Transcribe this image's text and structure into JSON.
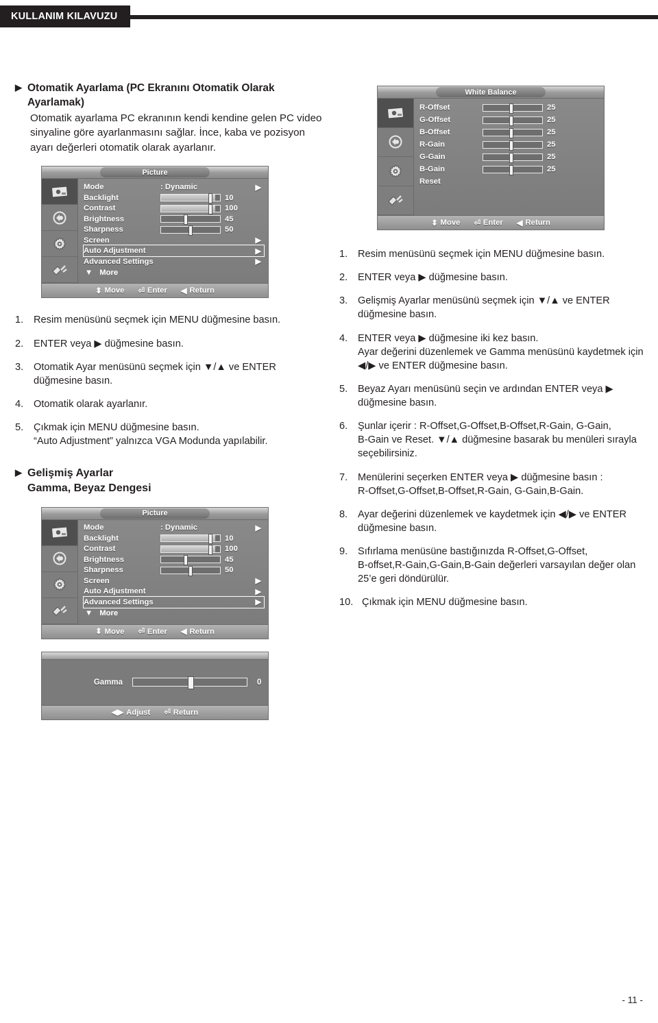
{
  "header": {
    "tab_label": "KULLANIM KILAVUZU"
  },
  "page_footer": "- 11 -",
  "left": {
    "heading": "Otomatik Ayarlama (PC Ekranını Otomatik Olarak Ayarlamak)",
    "paragraph": "Otomatik ayarlama PC ekranının kendi kendine gelen PC video sinyaline göre ayarlanmasını sağlar. İnce, kaba ve pozisyon ayarı değerleri otomatik olarak ayarlanır.",
    "steps": [
      {
        "num": "1.",
        "text": "Resim menüsünü seçmek için MENU düğmesine basın.",
        "sub": ""
      },
      {
        "num": "2.",
        "text": "ENTER veya ▶ düğmesine basın.",
        "sub": ""
      },
      {
        "num": "3.",
        "text": "Otomatik Ayar menüsünü seçmek için ▼/▲ ve ENTER",
        "sub": "düğmesine basın."
      },
      {
        "num": "4.",
        "text": "Otomatik olarak ayarlanır.",
        "sub": ""
      },
      {
        "num": "5.",
        "text": "Çıkmak için MENU düğmesine basın.",
        "sub": "“Auto Adjustment” yalnızca VGA Modunda yapılabilir."
      }
    ],
    "section_head_line1": "Gelişmiş Ayarlar",
    "section_head_line2": "Gamma, Beyaz Dengesi"
  },
  "right": {
    "steps": [
      {
        "num": "1.",
        "text": "Resim menüsünü seçmek için MENU düğmesine basın.",
        "sub": ""
      },
      {
        "num": "2.",
        "text": "ENTER veya ▶ düğmesine basın.",
        "sub": ""
      },
      {
        "num": "3.",
        "text": "Gelişmiş Ayarlar menüsünü seçmek için ▼/▲ ve ENTER",
        "sub": "düğmesine basın."
      },
      {
        "num": "4.",
        "text": "ENTER veya ▶ düğmesine iki kez basın.",
        "sub": "Ayar değerini düzenlemek ve Gamma menüsünü kaydetmek için ◀/▶ ve ENTER düğmesine basın."
      },
      {
        "num": "5.",
        "text": "Beyaz Ayarı menüsünü seçin ve ardından ENTER veya ▶",
        "sub": "düğmesine basın."
      },
      {
        "num": "6.",
        "text": "Şunlar içerir : R-Offset,G-Offset,B-Offset,R-Gain, G-Gain,",
        "sub": "B-Gain ve Reset. ▼/▲ düğmesine basarak bu menüleri sırayla seçebilirsiniz."
      },
      {
        "num": "7.",
        "text": "Menülerini seçerken ENTER veya ▶ düğmesine basın :",
        "sub": "R-Offset,G-Offset,B-Offset,R-Gain, G-Gain,B-Gain."
      },
      {
        "num": "8.",
        "text": "Ayar değerini düzenlemek ve kaydetmek için ◀/▶ ve ENTER",
        "sub": "düğmesine basın."
      },
      {
        "num": "9.",
        "text": "Sıfırlama menüsüne bastığınızda R-Offset,G-Offset,",
        "sub": "B-offset,R-Gain,G-Gain,B-Gain değerleri varsayılan değer olan 25’e geri döndürülür."
      },
      {
        "num": "10.",
        "text": "Çıkmak için MENU düğmesine basın.",
        "sub": ""
      }
    ]
  },
  "osd_common": {
    "rail_icons": [
      "picture-icon",
      "sound-icon",
      "setup-icon",
      "input-icon"
    ],
    "footer": {
      "move": "Move",
      "enter": "Enter",
      "return": "Return"
    },
    "more_label": "More"
  },
  "picture_menu_1": {
    "title": "Picture",
    "rows": [
      {
        "label": "Mode",
        "value": ": Dynamic",
        "arrow": "▶",
        "type": "value"
      },
      {
        "label": "Backlight",
        "num": "10",
        "type": "bar",
        "fill": 96,
        "knob": 80
      },
      {
        "label": "Contrast",
        "num": "100",
        "type": "bar",
        "fill": 96,
        "knob": 80
      },
      {
        "label": "Brightness",
        "num": "45",
        "type": "bar",
        "fill": 0,
        "knob": 38
      },
      {
        "label": "Sharpness",
        "num": "50",
        "type": "bar",
        "fill": 0,
        "knob": 44
      },
      {
        "label": "Screen",
        "arrow": "▶",
        "type": "arrow"
      },
      {
        "label": "Auto Adjustment",
        "arrow": "▶",
        "type": "arrow",
        "selected": true
      },
      {
        "label": "Advanced Settings",
        "arrow": "▶",
        "type": "arrow"
      }
    ]
  },
  "picture_menu_2": {
    "title": "Picture",
    "rows": [
      {
        "label": "Mode",
        "value": ": Dynamic",
        "arrow": "▶",
        "type": "value"
      },
      {
        "label": "Backlight",
        "num": "10",
        "type": "bar",
        "fill": 96,
        "knob": 80
      },
      {
        "label": "Contrast",
        "num": "100",
        "type": "bar",
        "fill": 96,
        "knob": 80
      },
      {
        "label": "Brightness",
        "num": "45",
        "type": "bar",
        "fill": 0,
        "knob": 38
      },
      {
        "label": "Sharpness",
        "num": "50",
        "type": "bar",
        "fill": 0,
        "knob": 44
      },
      {
        "label": "Screen",
        "arrow": "▶",
        "type": "arrow"
      },
      {
        "label": "Auto Adjustment",
        "arrow": "▶",
        "type": "arrow"
      },
      {
        "label": "Advanced Settings",
        "arrow": "▶",
        "type": "arrow",
        "selected": true
      }
    ]
  },
  "white_balance_menu": {
    "title": "White Balance",
    "rows": [
      {
        "label": "R-Offset",
        "num": "25",
        "type": "bar",
        "fill": 0,
        "knob": 44
      },
      {
        "label": "G-Offset",
        "num": "25",
        "type": "bar",
        "fill": 0,
        "knob": 44
      },
      {
        "label": "B-Offset",
        "num": "25",
        "type": "bar",
        "fill": 0,
        "knob": 44
      },
      {
        "label": "R-Gain",
        "num": "25",
        "type": "bar",
        "fill": 0,
        "knob": 44
      },
      {
        "label": "G-Gain",
        "num": "25",
        "type": "bar",
        "fill": 0,
        "knob": 44
      },
      {
        "label": "B-Gain",
        "num": "25",
        "type": "bar",
        "fill": 0,
        "knob": 44
      },
      {
        "label": "Reset",
        "type": "plain"
      }
    ]
  },
  "gamma_panel": {
    "label": "Gamma",
    "value": "0",
    "footer": {
      "adjust": "Adjust",
      "return": "Return"
    }
  }
}
